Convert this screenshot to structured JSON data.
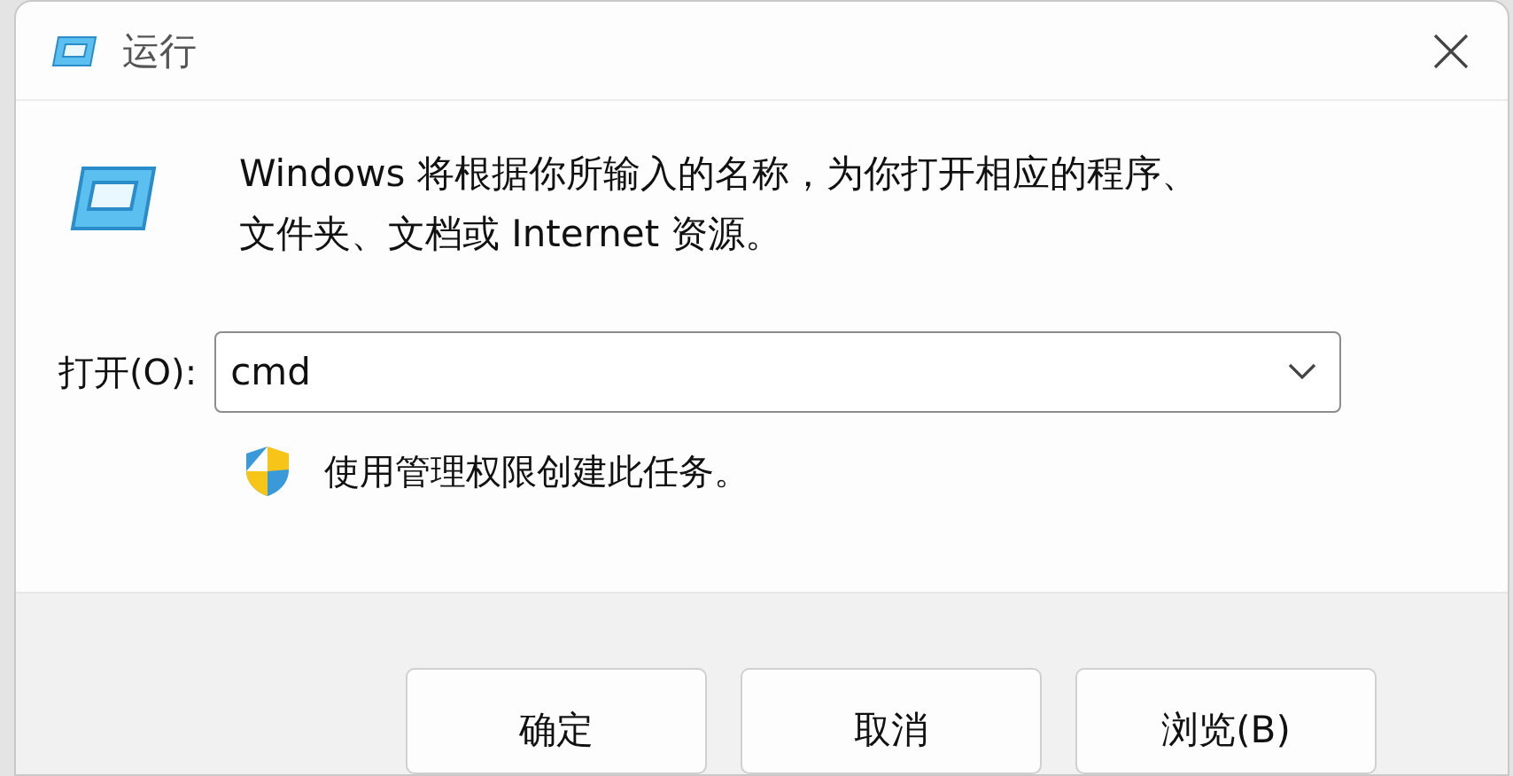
{
  "window": {
    "title": "运行"
  },
  "message": "Windows 将根据你所输入的名称，为你打开相应的程序、文件夹、文档或 Internet 资源。",
  "open_field": {
    "label": "打开(O):",
    "value": "cmd"
  },
  "admin_note": "使用管理权限创建此任务。",
  "buttons": [
    "确定",
    "取消",
    "浏览(B)"
  ]
}
